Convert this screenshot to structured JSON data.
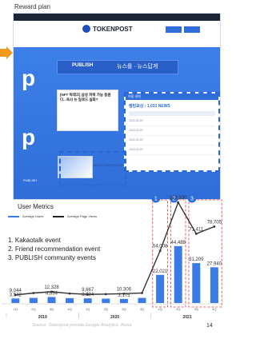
{
  "section_title": "Reward plan",
  "screenshot": {
    "logo_text": "TOKENPOST",
    "banner_text": "PUBLISH",
    "banner_korean": "뉴스를 · 뉴스답게",
    "article_title": "[NFT 빅테크] 삼성 파워 가능 동원다...옥사 뉴 일로드 실화?",
    "popup_header_left": "이용 내역",
    "popup_title": "랭킹보상 : 1,031 NEWS",
    "popup_rows": [
      "2022.02.20",
      "2022.02.20",
      "2022.02.20",
      "2022.02.20"
    ],
    "thumb_caption": "NEWS가 지급되었습니다"
  },
  "metrics": {
    "title": "User Metrics",
    "legend": [
      "Average Users",
      "Average Page Views"
    ],
    "events": [
      "1. Kakaotalk event",
      "2. Friend recommendation event",
      "3. PUBLISH community events"
    ],
    "source": "Source: Tokenpost provide,Google Analytics, Alexa",
    "page_number": "14",
    "markers": [
      "1",
      "2",
      "3"
    ]
  },
  "chart_data": {
    "type": "bar",
    "categories": [
      "1Q",
      "2Q",
      "3Q",
      "4Q",
      "1Q",
      "2Q",
      "3Q",
      "4Q",
      "1Q",
      "2Q",
      "3Q",
      "4Q"
    ],
    "years": [
      "2019",
      "2020",
      "2021"
    ],
    "series": [
      {
        "name": "Average Users",
        "values": [
          3542,
          4000,
          4694,
          3800,
          3634,
          3400,
          3175,
          4000,
          22021,
          44488,
          31209,
          27940
        ]
      },
      {
        "name": "Average Page Views",
        "values": [
          9044,
          11000,
          12328,
          10500,
          9667,
          9900,
          10306,
          11000,
          54008,
          103330,
          71411,
          78705
        ]
      }
    ],
    "value_labels": {
      "users": [
        {
          "i": 0,
          "text": "3,542"
        },
        {
          "i": 2,
          "text": "4,694"
        },
        {
          "i": 4,
          "text": "3,634"
        },
        {
          "i": 6,
          "text": "3,175"
        },
        {
          "i": 8,
          "text": "22,021"
        },
        {
          "i": 9,
          "text": "44,488"
        },
        {
          "i": 10,
          "text": "31,209"
        },
        {
          "i": 11,
          "text": "27,940"
        }
      ],
      "views": [
        {
          "i": 0,
          "text": "9,044"
        },
        {
          "i": 2,
          "text": "12,328"
        },
        {
          "i": 4,
          "text": "9,667"
        },
        {
          "i": 6,
          "text": "10,306"
        },
        {
          "i": 8,
          "text": "54,008"
        },
        {
          "i": 9,
          "text": "103,330"
        },
        {
          "i": 10,
          "text": "71,411"
        },
        {
          "i": 11,
          "text": "78,705"
        }
      ]
    }
  }
}
